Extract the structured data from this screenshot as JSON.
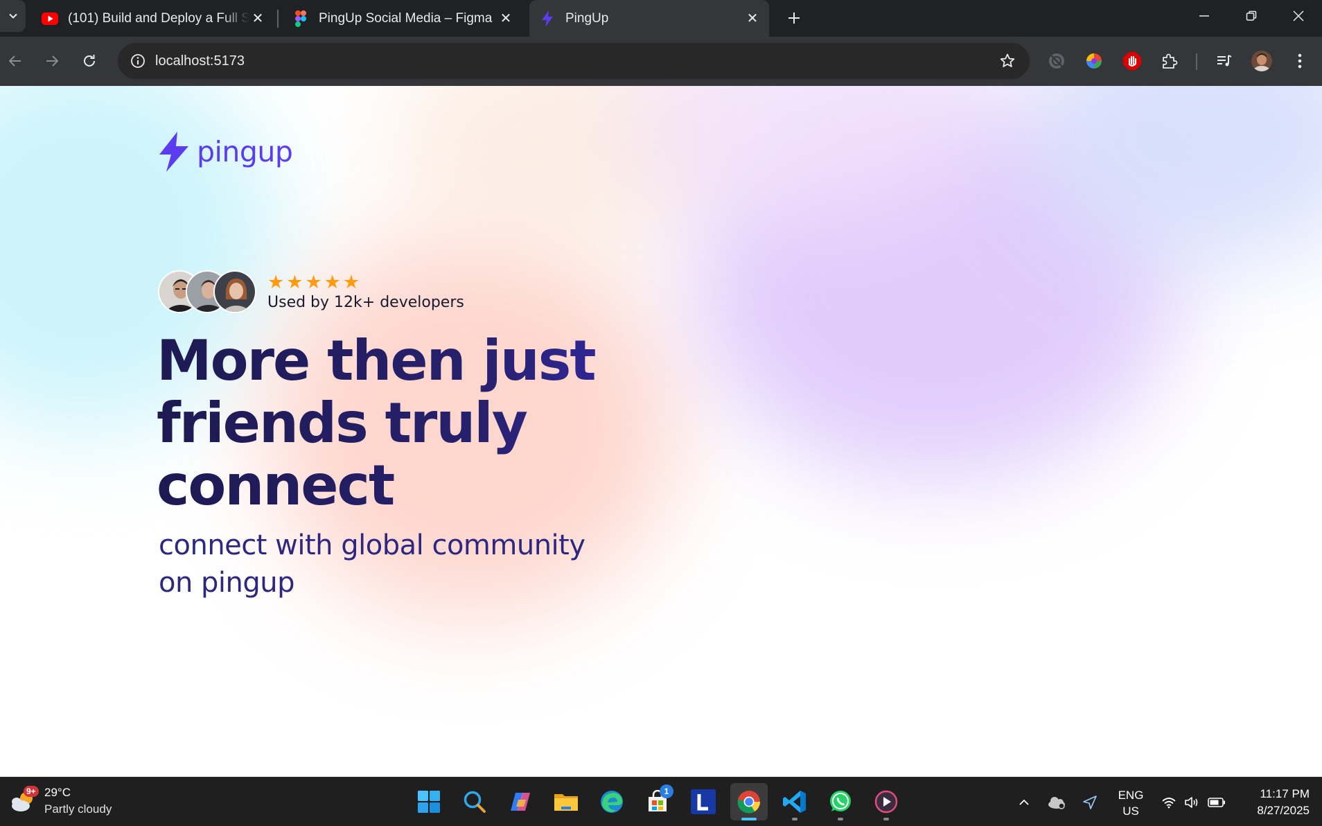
{
  "browser": {
    "tabs": [
      {
        "title": "(101) Build and Deploy a Full Sta",
        "icon": "youtube-icon"
      },
      {
        "title": "PingUp Social Media – Figma",
        "icon": "figma-icon"
      },
      {
        "title": "PingUp",
        "icon": "bolt-icon",
        "active": true
      }
    ],
    "url": "localhost:5173"
  },
  "page": {
    "logo_text": "pingup",
    "rating_stars": 5,
    "used_by": "Used by 12k+ developers",
    "headline_line1": "More then just",
    "headline_line2": "friends truly",
    "headline_line3": "connect",
    "subheadline_line1": "connect with global community",
    "subheadline_line2": "on pingup",
    "colors": {
      "brand": "#5b3cf0",
      "headline": "#1d1a52",
      "star": "#fe9b0f"
    }
  },
  "taskbar": {
    "weather_temp": "29°C",
    "weather_condition": "Partly cloudy",
    "weather_badge": "9+",
    "store_badge": "1",
    "lang_line1": "ENG",
    "lang_line2": "US",
    "time": "11:17 PM",
    "date": "8/27/2025",
    "apps": [
      "windows-start",
      "search",
      "copilot",
      "file-explorer",
      "edge",
      "microsoft-store",
      "L-app",
      "chrome",
      "vscode",
      "whatsapp",
      "media-player"
    ]
  }
}
